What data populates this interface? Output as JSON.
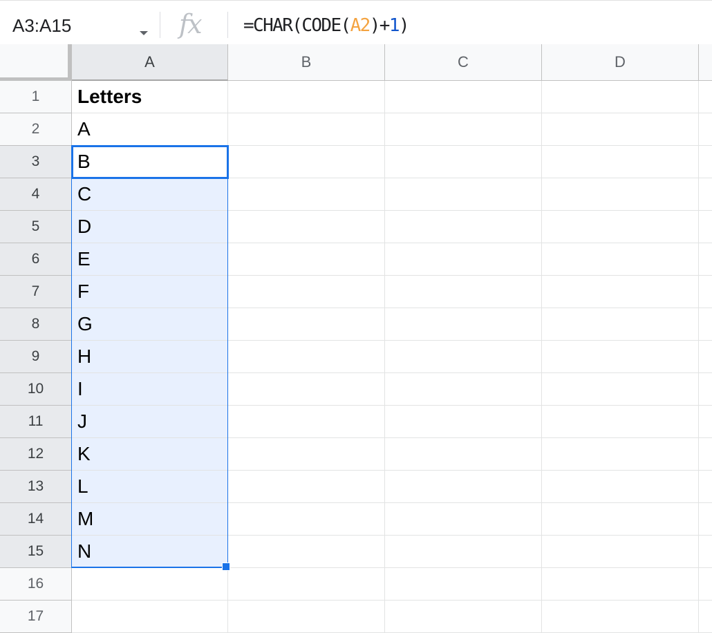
{
  "formula_bar": {
    "name_box": "A3:A15",
    "fx_label": "fx",
    "formula_tokens": [
      {
        "text": "=CHAR(CODE(",
        "kind": "plain"
      },
      {
        "text": "A2",
        "kind": "ref"
      },
      {
        "text": ")+",
        "kind": "plain"
      },
      {
        "text": "1",
        "kind": "num"
      },
      {
        "text": ")",
        "kind": "plain"
      }
    ]
  },
  "columns": [
    "A",
    "B",
    "C",
    "D"
  ],
  "rows": [
    {
      "label": "1",
      "cells": [
        "Letters",
        "",
        "",
        ""
      ]
    },
    {
      "label": "2",
      "cells": [
        "A",
        "",
        "",
        ""
      ]
    },
    {
      "label": "3",
      "cells": [
        "B",
        "",
        "",
        ""
      ]
    },
    {
      "label": "4",
      "cells": [
        "C",
        "",
        "",
        ""
      ]
    },
    {
      "label": "5",
      "cells": [
        "D",
        "",
        "",
        ""
      ]
    },
    {
      "label": "6",
      "cells": [
        "E",
        "",
        "",
        ""
      ]
    },
    {
      "label": "7",
      "cells": [
        "F",
        "",
        "",
        ""
      ]
    },
    {
      "label": "8",
      "cells": [
        "G",
        "",
        "",
        ""
      ]
    },
    {
      "label": "9",
      "cells": [
        "H",
        "",
        "",
        ""
      ]
    },
    {
      "label": "10",
      "cells": [
        "I",
        "",
        "",
        ""
      ]
    },
    {
      "label": "11",
      "cells": [
        "J",
        "",
        "",
        ""
      ]
    },
    {
      "label": "12",
      "cells": [
        "K",
        "",
        "",
        ""
      ]
    },
    {
      "label": "13",
      "cells": [
        "L",
        "",
        "",
        ""
      ]
    },
    {
      "label": "14",
      "cells": [
        "M",
        "",
        "",
        ""
      ]
    },
    {
      "label": "15",
      "cells": [
        "N",
        "",
        "",
        ""
      ]
    },
    {
      "label": "16",
      "cells": [
        "",
        "",
        "",
        ""
      ]
    },
    {
      "label": "17",
      "cells": [
        "",
        "",
        "",
        ""
      ]
    }
  ],
  "selection": {
    "range": "A3:A15",
    "active_cell": "A3"
  },
  "colors": {
    "selection_border": "#1a73e8",
    "selection_fill": "#e8f0fe",
    "ref_token": "#f4a340",
    "number_token": "#1155cc"
  }
}
